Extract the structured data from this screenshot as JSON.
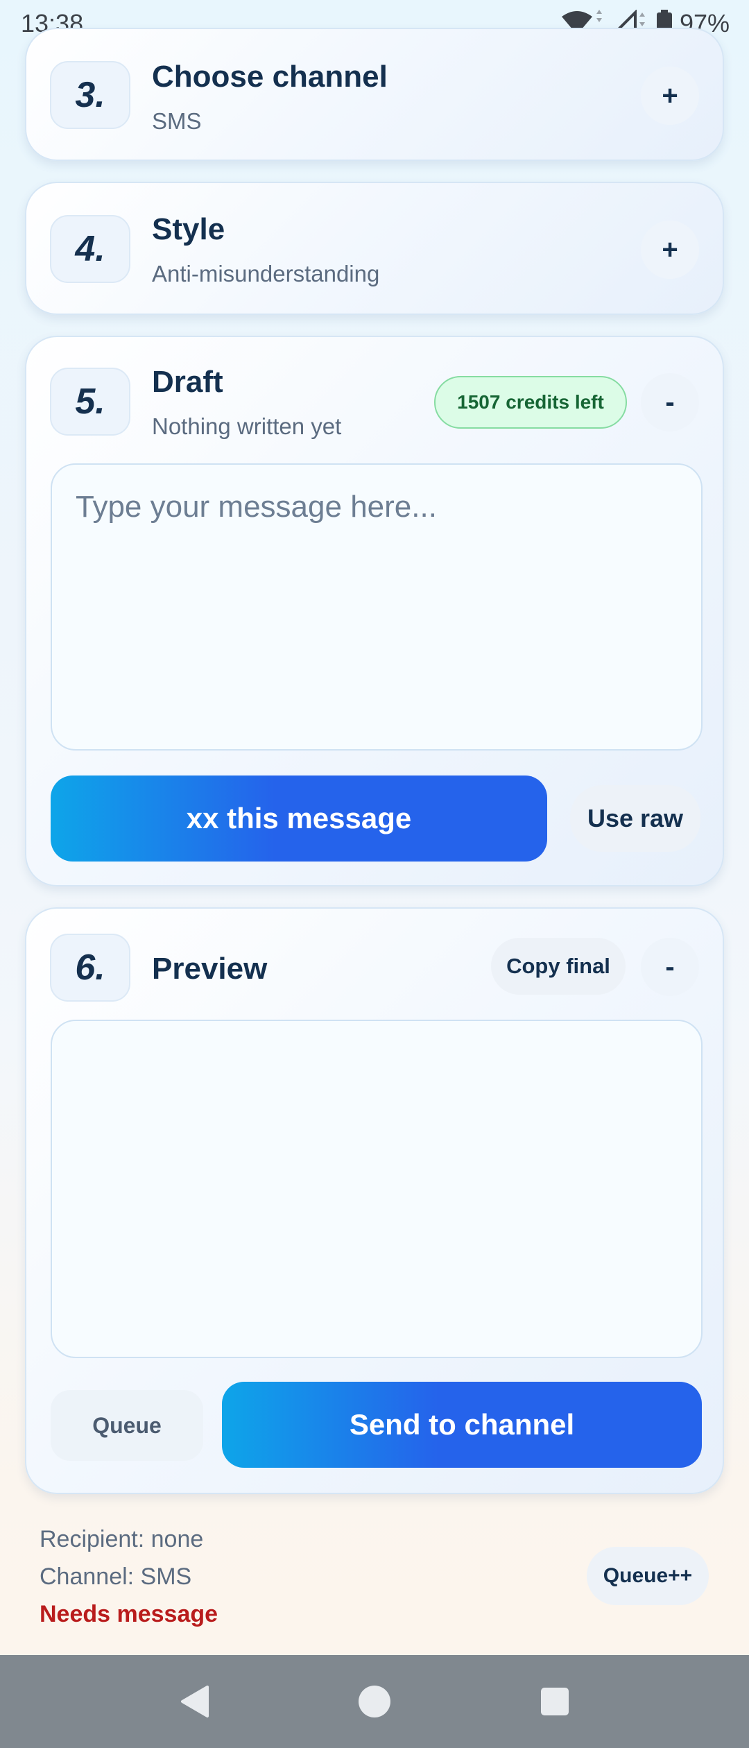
{
  "status_bar": {
    "time": "13:38",
    "battery": "97%",
    "icons": [
      "wifi-icon",
      "cell-signal-icon",
      "battery-icon"
    ]
  },
  "steps": [
    {
      "number": "3.",
      "title": "Choose channel",
      "subtitle": "SMS",
      "toggle": "+"
    },
    {
      "number": "4.",
      "title": "Style",
      "subtitle": "Anti-misunderstanding",
      "toggle": "+"
    },
    {
      "number": "5.",
      "title": "Draft",
      "subtitle": "Nothing written yet",
      "toggle": "-",
      "credits_badge": "1507 credits left",
      "input_placeholder": "Type your message here...",
      "input_value": "",
      "primary_button": "xx this message",
      "secondary_button": "Use raw"
    },
    {
      "number": "6.",
      "title": "Preview",
      "toggle": "-",
      "copy_button": "Copy final",
      "preview_text": "",
      "queue_button": "Queue",
      "send_button": "Send to channel"
    }
  ],
  "footer": {
    "recipient": "Recipient: none",
    "channel": "Channel: SMS",
    "warning": "Needs message",
    "queue_plus_button": "Queue++"
  },
  "colors": {
    "accent_start": "#0ea5e9",
    "accent_end": "#2563eb",
    "credits_bg": "#dcfce7",
    "credits_text": "#166534",
    "warning": "#b91c1c",
    "nav_bar": "#80888f"
  }
}
